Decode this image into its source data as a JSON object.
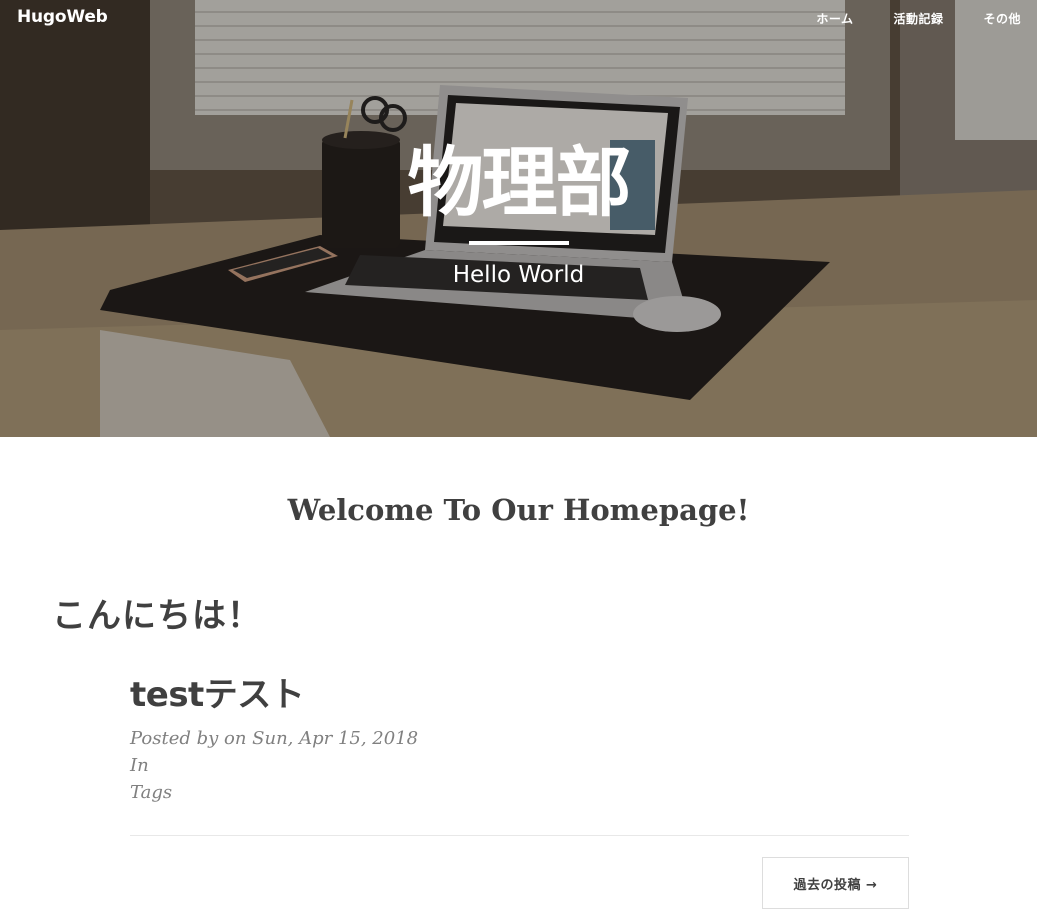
{
  "navbar": {
    "brand": "HugoWeb",
    "links": [
      "ホーム",
      "活動記録",
      "その他"
    ]
  },
  "hero": {
    "title": "物理部",
    "subtitle": "Hello World",
    "image": "laptop-on-desk-photo"
  },
  "main": {
    "welcome_heading": "Welcome To Our Homepage!",
    "greeting": "こんにちは！"
  },
  "post": {
    "title": "testテスト",
    "posted_line": "Posted by on Sun, Apr 15, 2018",
    "in_label": "In",
    "tags_label": "Tags"
  },
  "pager": {
    "older_label": "過去の投稿 →"
  },
  "colors": {
    "text": "#404040",
    "meta": "#808080",
    "hero_text": "#ffffff"
  }
}
